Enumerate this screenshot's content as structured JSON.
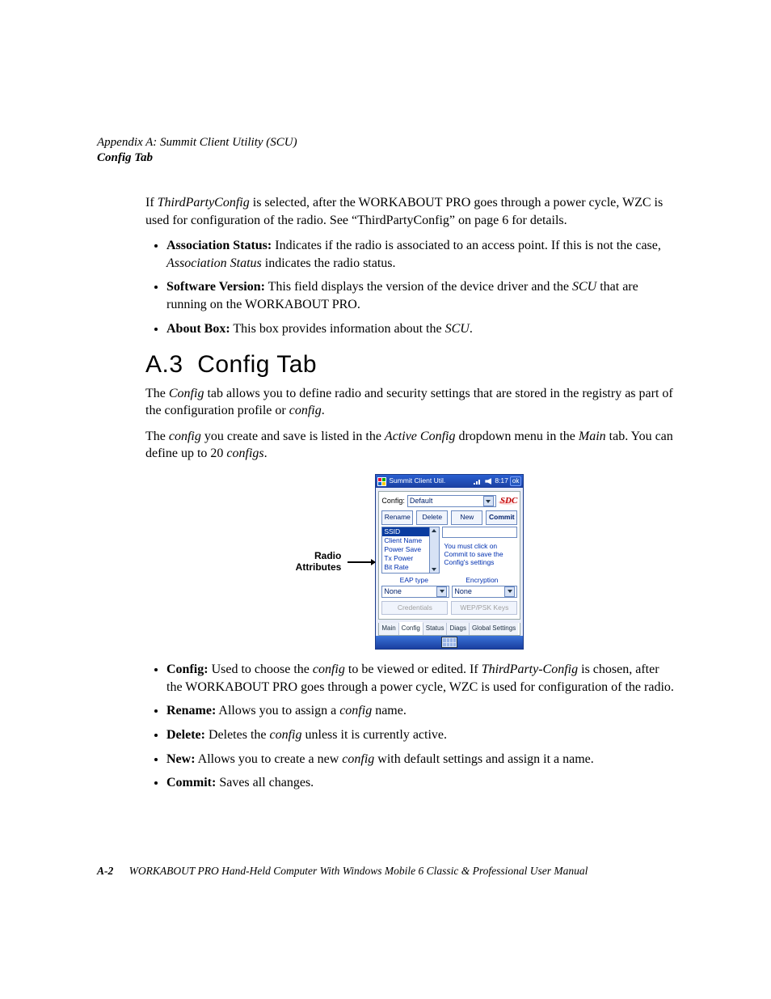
{
  "header": {
    "line1": "Appendix  A:  Summit Client Utility (SCU)",
    "line2": "Config Tab"
  },
  "intro": {
    "p1a": "If ",
    "p1b": "ThirdPartyConfig",
    "p1c": " is selected, after the WORKABOUT PRO goes through a power cycle, WZC is used for configuration of the radio. See “ThirdPartyConfig” on page 6 for details."
  },
  "bullets1": [
    {
      "b": "Association Status:",
      "t1": " Indicates if the radio is associated to an access point. If this is not the case, ",
      "i": "Association Status",
      "t2": " indicates the radio status."
    },
    {
      "b": "Software Version:",
      "t1": " This field displays the version of the device driver and the ",
      "i": "SCU",
      "t2": " that are running on the WORKABOUT PRO."
    },
    {
      "b": "About Box:",
      "t1": " This box provides information about the ",
      "i": "SCU",
      "t2": "."
    }
  ],
  "section": {
    "num": "A.3",
    "title": "Config Tab"
  },
  "section_body": {
    "p1a": "The ",
    "p1b": "Config",
    "p1c": " tab allows you to define radio and security settings that are stored in the registry as part of the configuration profile or ",
    "p1d": "config",
    "p1e": ".",
    "p2a": "The ",
    "p2b": "config",
    "p2c": " you create and save is listed in the ",
    "p2d": "Active Config",
    "p2e": " dropdown menu in the ",
    "p2f": "Main",
    "p2g": " tab. You can define up to 20 ",
    "p2h": "configs",
    "p2i": "."
  },
  "callout": {
    "l1": "Radio",
    "l2": "Attributes"
  },
  "scu": {
    "title": "Summit Client Util.",
    "clock": "8:17",
    "ok": "ok",
    "config_label": "Config:",
    "config_value": "Default",
    "logo": "SDC",
    "buttons": {
      "rename": "Rename",
      "delete": "Delete",
      "new": "New",
      "commit": "Commit"
    },
    "list": [
      "SSID",
      "Client Name",
      "Power Save",
      "Tx Power",
      "Bit Rate"
    ],
    "hint1": "You must click on",
    "hint2": "Commit to save the",
    "hint3": "Config's settings",
    "eap_label": "EAP type",
    "enc_label": "Encryption",
    "eap_value": "None",
    "enc_value": "None",
    "cred": "Credentials",
    "wep": "WEP/PSK Keys",
    "tabs": [
      "Main",
      "Config",
      "Status",
      "Diags",
      "Global Settings"
    ]
  },
  "bullets2": [
    {
      "b": "Config:",
      "t": " Used to choose the ",
      "i1": "config",
      "t2": " to be viewed or edited. If ",
      "i2": "ThirdParty-Config",
      "t3": " is chosen, after the WORKABOUT PRO goes through a power cycle, WZC is used for configuration of the radio."
    },
    {
      "b": "Rename:",
      "t": " Allows you to assign a ",
      "i1": "config",
      "t2": " name."
    },
    {
      "b": "Delete:",
      "t": " Deletes the ",
      "i1": "config",
      "t2": " unless it is currently active."
    },
    {
      "b": "New:",
      "t": " Allows you to create a new ",
      "i1": "config",
      "t2": " with default settings and assign it a name."
    },
    {
      "b": "Commit:",
      "t": " Saves all changes."
    }
  ],
  "footer": {
    "page": "A-2",
    "text": "WORKABOUT PRO Hand-Held Computer With Windows Mobile 6 Classic & Professional User Manual"
  }
}
